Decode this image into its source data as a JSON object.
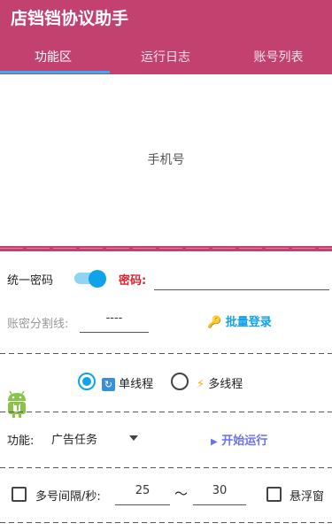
{
  "app": {
    "title": "店铛铛协议助手"
  },
  "tabs": [
    {
      "label": "功能区"
    },
    {
      "label": "运行日志"
    },
    {
      "label": "账号列表"
    }
  ],
  "phone_panel": {
    "label": "手机号"
  },
  "password_row": {
    "toggle_label": "统一密码",
    "password_label": "密码:",
    "password_value": ""
  },
  "separator_row": {
    "label": "账密分割线:",
    "value": "----",
    "batch_login_label": "批量登录",
    "batch_login_icon": "key-icon"
  },
  "thread_row": {
    "single_label": "单线程",
    "single_icon": "cycle-icon",
    "multi_label": "多线程",
    "multi_icon": "lightning-icon"
  },
  "function_row": {
    "label": "功能:",
    "selected": "广告任务",
    "start_label": "开始运行"
  },
  "interval_row": {
    "label": "多号间隔/秒:",
    "min": "25",
    "tilde": "～",
    "max": "30",
    "float_label": "悬浮窗"
  },
  "colors": {
    "primary": "#c2416f",
    "accent": "#10a3ec",
    "password_label": "#e0202e",
    "batch_login": "#10a3ec",
    "start_button": "#6b6ff2"
  }
}
